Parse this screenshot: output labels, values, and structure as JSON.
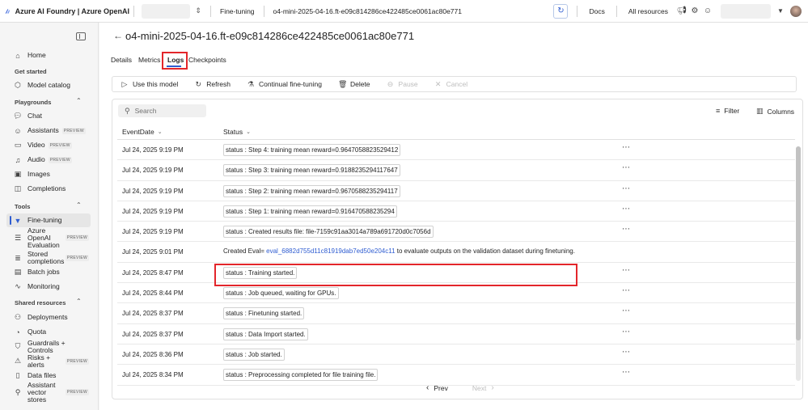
{
  "topbar": {
    "app_title": "Azure AI Foundry | Azure OpenAI",
    "breadcrumb_1": "Fine-tuning",
    "breadcrumb_2": "o4-mini-2025-04-16.ft-e09c814286ce422485ce0061ac80e771",
    "docs": "Docs",
    "all_resources": "All resources"
  },
  "sidebar": {
    "home": "Home",
    "get_started": "Get started",
    "model_catalog": "Model catalog",
    "playgrounds": "Playgrounds",
    "chat": "Chat",
    "assistants": "Assistants",
    "video": "Video",
    "audio": "Audio",
    "images": "Images",
    "completions": "Completions",
    "tools": "Tools",
    "fine_tuning": "Fine-tuning",
    "aoai_eval_1": "Azure OpenAI",
    "aoai_eval_2": "Evaluation",
    "stored_1": "Stored",
    "stored_2": "completions",
    "batch_jobs": "Batch jobs",
    "monitoring": "Monitoring",
    "shared_resources": "Shared resources",
    "deployments": "Deployments",
    "quota": "Quota",
    "guardrails": "Guardrails + Controls",
    "risks": "Risks + alerts",
    "data_files": "Data files",
    "vector_1": "Assistant",
    "vector_2": "vector stores",
    "preview": "PREVIEW"
  },
  "main": {
    "title": "o4-mini-2025-04-16.ft-e09c814286ce422485ce0061ac80e771",
    "tabs": {
      "details": "Details",
      "metrics": "Metrics",
      "logs": "Logs",
      "checkpoints": "Checkpoints"
    },
    "toolbar": {
      "use_model": "Use this model",
      "refresh": "Refresh",
      "continual": "Continual fine-tuning",
      "delete": "Delete",
      "pause": "Pause",
      "cancel": "Cancel"
    },
    "search_placeholder": "Search",
    "filter": "Filter",
    "columns": "Columns",
    "col_date": "EventDate",
    "col_status": "Status",
    "rows": [
      {
        "date": "Jul 24, 2025 9:19 PM",
        "status": "status : Step 4: training mean reward=0.9647058823529412"
      },
      {
        "date": "Jul 24, 2025 9:19 PM",
        "status": "status : Step 3: training mean reward=0.9188235294117647"
      },
      {
        "date": "Jul 24, 2025 9:19 PM",
        "status": "status : Step 2: training mean reward=0.9670588235294117"
      },
      {
        "date": "Jul 24, 2025 9:19 PM",
        "status": "status : Step 1: training mean reward=0.916470588235294"
      },
      {
        "date": "Jul 24, 2025 9:19 PM",
        "status": "status : Created results file: file-7159c91aa3014a789a691720d0c7056d"
      },
      {
        "date": "Jul 24, 2025 9:01 PM",
        "status_pre": "Created Eval= ",
        "status_link": "eval_6882d755d11c81919dab7ed50e204c11",
        "status_post": " to evaluate outputs on the validation dataset during finetuning."
      },
      {
        "date": "Jul 24, 2025 8:47 PM",
        "status": "status : Training started."
      },
      {
        "date": "Jul 24, 2025 8:44 PM",
        "status": "status : Job queued, waiting for GPUs."
      },
      {
        "date": "Jul 24, 2025 8:37 PM",
        "status": "status : Finetuning started."
      },
      {
        "date": "Jul 24, 2025 8:37 PM",
        "status": "status : Data Import started."
      },
      {
        "date": "Jul 24, 2025 8:36 PM",
        "status": "status : Job started."
      },
      {
        "date": "Jul 24, 2025 8:34 PM",
        "status": "status : Preprocessing completed for file training file."
      }
    ],
    "prev": "Prev",
    "next": "Next"
  }
}
